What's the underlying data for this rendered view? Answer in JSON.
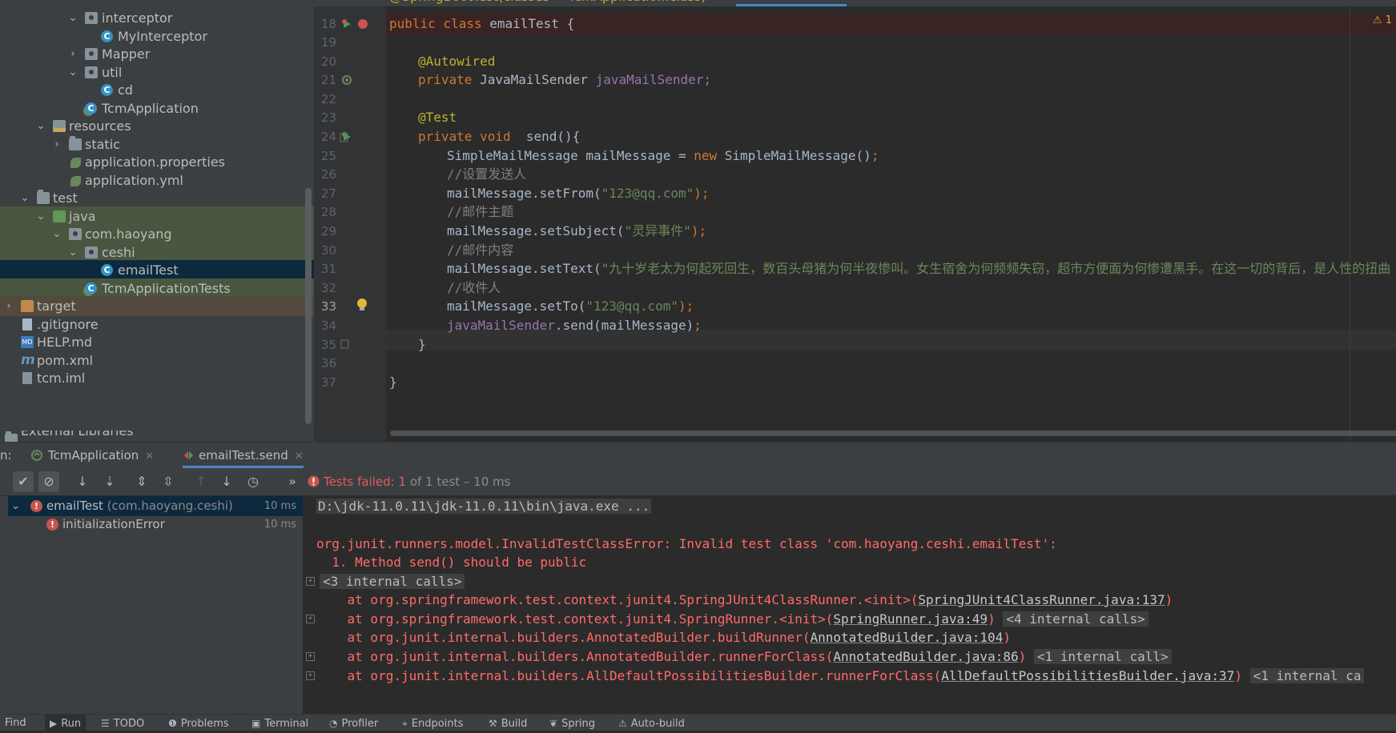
{
  "project_tree": {
    "items": [
      {
        "label": "interceptor",
        "icon": "package-icon"
      },
      {
        "label": "MyInterceptor",
        "icon": "class-icon"
      },
      {
        "label": "Mapper",
        "icon": "package-icon"
      },
      {
        "label": "util",
        "icon": "package-icon"
      },
      {
        "label": "cd",
        "icon": "class-icon"
      },
      {
        "label": "TcmApplication",
        "icon": "spring-class-icon"
      },
      {
        "label": "resources",
        "icon": "resources-folder-icon"
      },
      {
        "label": "static",
        "icon": "folder-icon"
      },
      {
        "label": "application.properties",
        "icon": "spring-config-icon"
      },
      {
        "label": "application.yml",
        "icon": "spring-config-icon"
      },
      {
        "label": "test",
        "icon": "folder-icon"
      },
      {
        "label": "java",
        "icon": "test-source-folder-icon"
      },
      {
        "label": "com.haoyang",
        "icon": "package-icon"
      },
      {
        "label": "ceshi",
        "icon": "package-icon"
      },
      {
        "label": "emailTest",
        "icon": "class-icon"
      },
      {
        "label": "TcmApplicationTests",
        "icon": "spring-class-icon"
      },
      {
        "label": "target",
        "icon": "excluded-folder-icon"
      },
      {
        "label": ".gitignore",
        "icon": "file-icon"
      },
      {
        "label": "HELP.md",
        "icon": "markdown-icon"
      },
      {
        "label": "pom.xml",
        "icon": "maven-icon"
      },
      {
        "label": "tcm.iml",
        "icon": "iml-file-icon"
      },
      {
        "label": "External Libraries",
        "icon": "library-icon"
      }
    ]
  },
  "editor": {
    "line_numbers": [
      "18",
      "19",
      "20",
      "21",
      "22",
      "23",
      "24",
      "25",
      "26",
      "27",
      "28",
      "29",
      "30",
      "31",
      "32",
      "33",
      "34",
      "35",
      "36",
      "37"
    ],
    "current_line": "33",
    "top_partial": "@SpringBootTest(classes = TcmApplication.class)",
    "lines": {
      "l18_kw": "public class ",
      "l18_name": "emailTest {",
      "l20": "@Autowired",
      "l21_kw": "private ",
      "l21_type": "JavaMailSender ",
      "l21_field": "javaMailSender",
      "l21_end": ";",
      "l23": "@Test",
      "l24_kw": "private void ",
      "l24_rest": " send(){",
      "l25_a": "SimpleMailMessage mailMessage = ",
      "l25_kw": "new ",
      "l25_b": "SimpleMailMessage()",
      "l25_end": ";",
      "l26": "//设置发送人",
      "l27_a": "mailMessage.setFrom(",
      "l27_str": "\"123@qq.com\"",
      "l27_end": ");",
      "l28": "//邮件主题",
      "l29_a": "mailMessage.setSubject(",
      "l29_str": "\"灵异事件\"",
      "l29_end": ");",
      "l30": "//邮件内容",
      "l31_a": "mailMessage.setText(",
      "l31_str": "\"九十岁老太为何起死回生，数百头母猪为何半夜惨叫。女生宿舍为何频频失窃，超市方便面为何惨遭黑手。在这一切的背后，是人性的扭曲",
      "l32": "//收件人",
      "l33_a": "mailMessage.setTo(",
      "l33_str": "\"123@qq.com\"",
      "l33_end": ");",
      "l34_field": "javaMailSender",
      "l34_rest": ".send(mailMessage)",
      "l34_end": ";",
      "l35": "}",
      "l37": "}"
    },
    "warning_count": "1"
  },
  "run_panel": {
    "label": "n:",
    "tabs": [
      {
        "label": "TcmApplication"
      },
      {
        "label": "emailTest.send"
      }
    ],
    "status_failed": "Tests failed: 1",
    "status_rest": " of 1 test – 10 ms",
    "test_tree": [
      {
        "name": "emailTest",
        "detail": " (com.haoyang.ceshi)",
        "time": "10 ms"
      },
      {
        "name": "initializationError",
        "detail": "",
        "time": "10 ms"
      }
    ],
    "console": {
      "cmd": "D:\\jdk-11.0.11\\jdk-11.0.11\\bin\\java.exe ...",
      "error": "org.junit.runners.model.InvalidTestClassError: Invalid test class 'com.haoyang.ceshi.emailTest':",
      "cause": "  1. Method send() should be public",
      "internal_calls_1": "<3 internal calls>",
      "st1_a": "    at org.springframework.test.context.junit4.SpringJUnit4ClassRunner.<init>(",
      "st1_link": "SpringJUnit4ClassRunner.java:137",
      "st1_end": ")",
      "st2_a": "    at org.springframework.test.context.junit4.SpringRunner.<init>(",
      "st2_link": "SpringRunner.java:49",
      "st2_end": ")",
      "st2_calls": "<4 internal calls>",
      "st3_a": "    at org.junit.internal.builders.AnnotatedBuilder.buildRunner(",
      "st3_link": "AnnotatedBuilder.java:104",
      "st3_end": ")",
      "st4_a": "    at org.junit.internal.builders.AnnotatedBuilder.runnerForClass(",
      "st4_link": "AnnotatedBuilder.java:86",
      "st4_end": ")",
      "st4_calls": "<1 internal call>",
      "st5_a": "    at org.junit.internal.builders.AllDefaultPossibilitiesBuilder.runnerForClass(",
      "st5_link": "AllDefaultPossibilitiesBuilder.java:37",
      "st5_end": ")",
      "st5_calls": "<1 internal ca"
    }
  },
  "bottom_bar": {
    "items": [
      {
        "label": "Find",
        "icon": "search-icon"
      },
      {
        "label": "Run",
        "icon": "run-icon"
      },
      {
        "label": "TODO",
        "icon": "todo-icon"
      },
      {
        "label": "Problems",
        "icon": "problems-icon"
      },
      {
        "label": "Terminal",
        "icon": "terminal-icon"
      },
      {
        "label": "Profiler",
        "icon": "profiler-icon"
      },
      {
        "label": "Endpoints",
        "icon": "endpoints-icon"
      },
      {
        "label": "Build",
        "icon": "build-icon"
      },
      {
        "label": "Spring",
        "icon": "spring-icon"
      },
      {
        "label": "Auto-build",
        "icon": "warning-icon"
      }
    ]
  },
  "colors": {
    "keyword": "#cc7832",
    "annotation": "#bbb529",
    "field": "#9876aa",
    "string": "#6a8759",
    "comment": "#808080",
    "error": "#ff6b68",
    "accent": "#4a88c7"
  }
}
